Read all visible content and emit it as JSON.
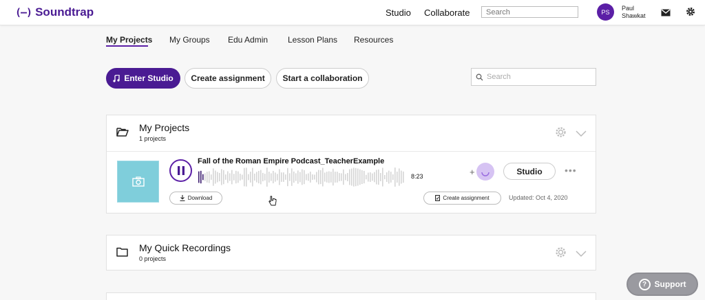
{
  "header": {
    "logo_mark": "(—)",
    "logo_text": "Soundtrap",
    "nav": [
      "Studio",
      "Collaborate"
    ],
    "search_placeholder": "Search",
    "avatar_initials": "PS",
    "user_first": "Paul",
    "user_last": "Shawkat"
  },
  "subnav": {
    "items": [
      "My Projects",
      "My Groups",
      "Edu Admin",
      "Lesson Plans",
      "Resources"
    ],
    "active": "My Projects"
  },
  "actions": {
    "enter_studio": "Enter Studio",
    "create_assignment": "Create assignment",
    "start_collaboration": "Start a collaboration",
    "search_placeholder": "Search"
  },
  "projects_card": {
    "title": "My Projects",
    "count": "1 projects",
    "project": {
      "title": "Fall of the Roman Empire Podcast_TeacherExample",
      "duration": "8:23",
      "download_label": "Download",
      "create_assignment_label": "Create assignment",
      "updated": "Updated: Oct 4, 2020",
      "studio_label": "Studio",
      "plus": "+",
      "more": "•••"
    }
  },
  "recordings_card": {
    "title": "My Quick Recordings",
    "count": "0 projects"
  },
  "support": {
    "label": "Support",
    "icon_glyph": "?"
  },
  "colors": {
    "brand": "#4a1b93",
    "thumbnail": "#7fcedb",
    "support_bg": "#9a9aa0"
  }
}
